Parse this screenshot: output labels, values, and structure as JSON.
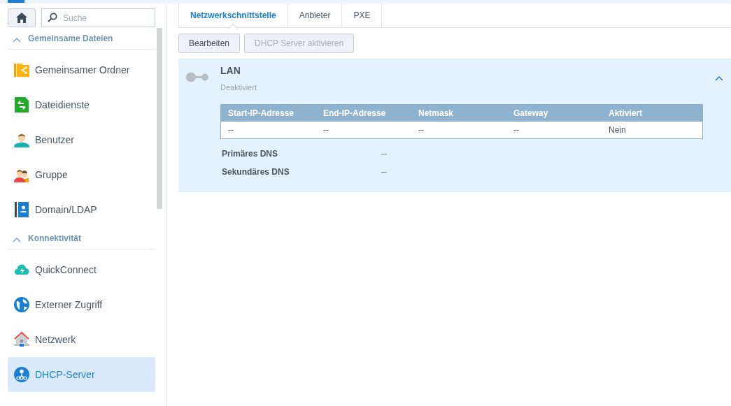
{
  "search": {
    "placeholder": "Suche"
  },
  "sidebar": {
    "sections": [
      {
        "title": "Gemeinsame Dateien",
        "expanded": true,
        "items": [
          {
            "label": "Gemeinsamer Ordner",
            "kind": "folder",
            "selected": false
          },
          {
            "label": "Dateidienste",
            "kind": "file",
            "selected": false
          },
          {
            "label": "Benutzer",
            "kind": "user",
            "selected": false
          },
          {
            "label": "Gruppe",
            "kind": "group",
            "selected": false
          },
          {
            "label": "Domain/LDAP",
            "kind": "directory",
            "selected": false
          }
        ]
      },
      {
        "title": "Konnektivität",
        "expanded": true,
        "items": [
          {
            "label": "QuickConnect",
            "kind": "cloud",
            "selected": false
          },
          {
            "label": "Externer Zugriff",
            "kind": "globe",
            "selected": false
          },
          {
            "label": "Netzwerk",
            "kind": "house",
            "selected": false
          },
          {
            "label": "DHCP-Server",
            "kind": "dhcp",
            "selected": true
          }
        ]
      }
    ]
  },
  "tabs": [
    {
      "label": "Netzwerkschnittstelle",
      "selected": true
    },
    {
      "label": "Anbieter",
      "selected": false
    },
    {
      "label": "PXE",
      "selected": false
    }
  ],
  "toolbar": [
    {
      "label": "Bearbeiten",
      "disabled": false
    },
    {
      "label": "DHCP Server aktivieren",
      "disabled": true
    }
  ],
  "interface": {
    "name": "LAN",
    "status": "Deaktiviert",
    "expanded": true,
    "table": {
      "columns": [
        "Start-IP-Adresse",
        "End-IP-Adresse",
        "Netmask",
        "Gateway",
        "Aktiviert"
      ],
      "rows": [
        [
          "--",
          "--",
          "--",
          "--",
          "Nein"
        ]
      ]
    },
    "details": [
      {
        "label": "Primäres DNS",
        "value": "--"
      },
      {
        "label": "Sekundäres DNS",
        "value": "--"
      }
    ]
  }
}
